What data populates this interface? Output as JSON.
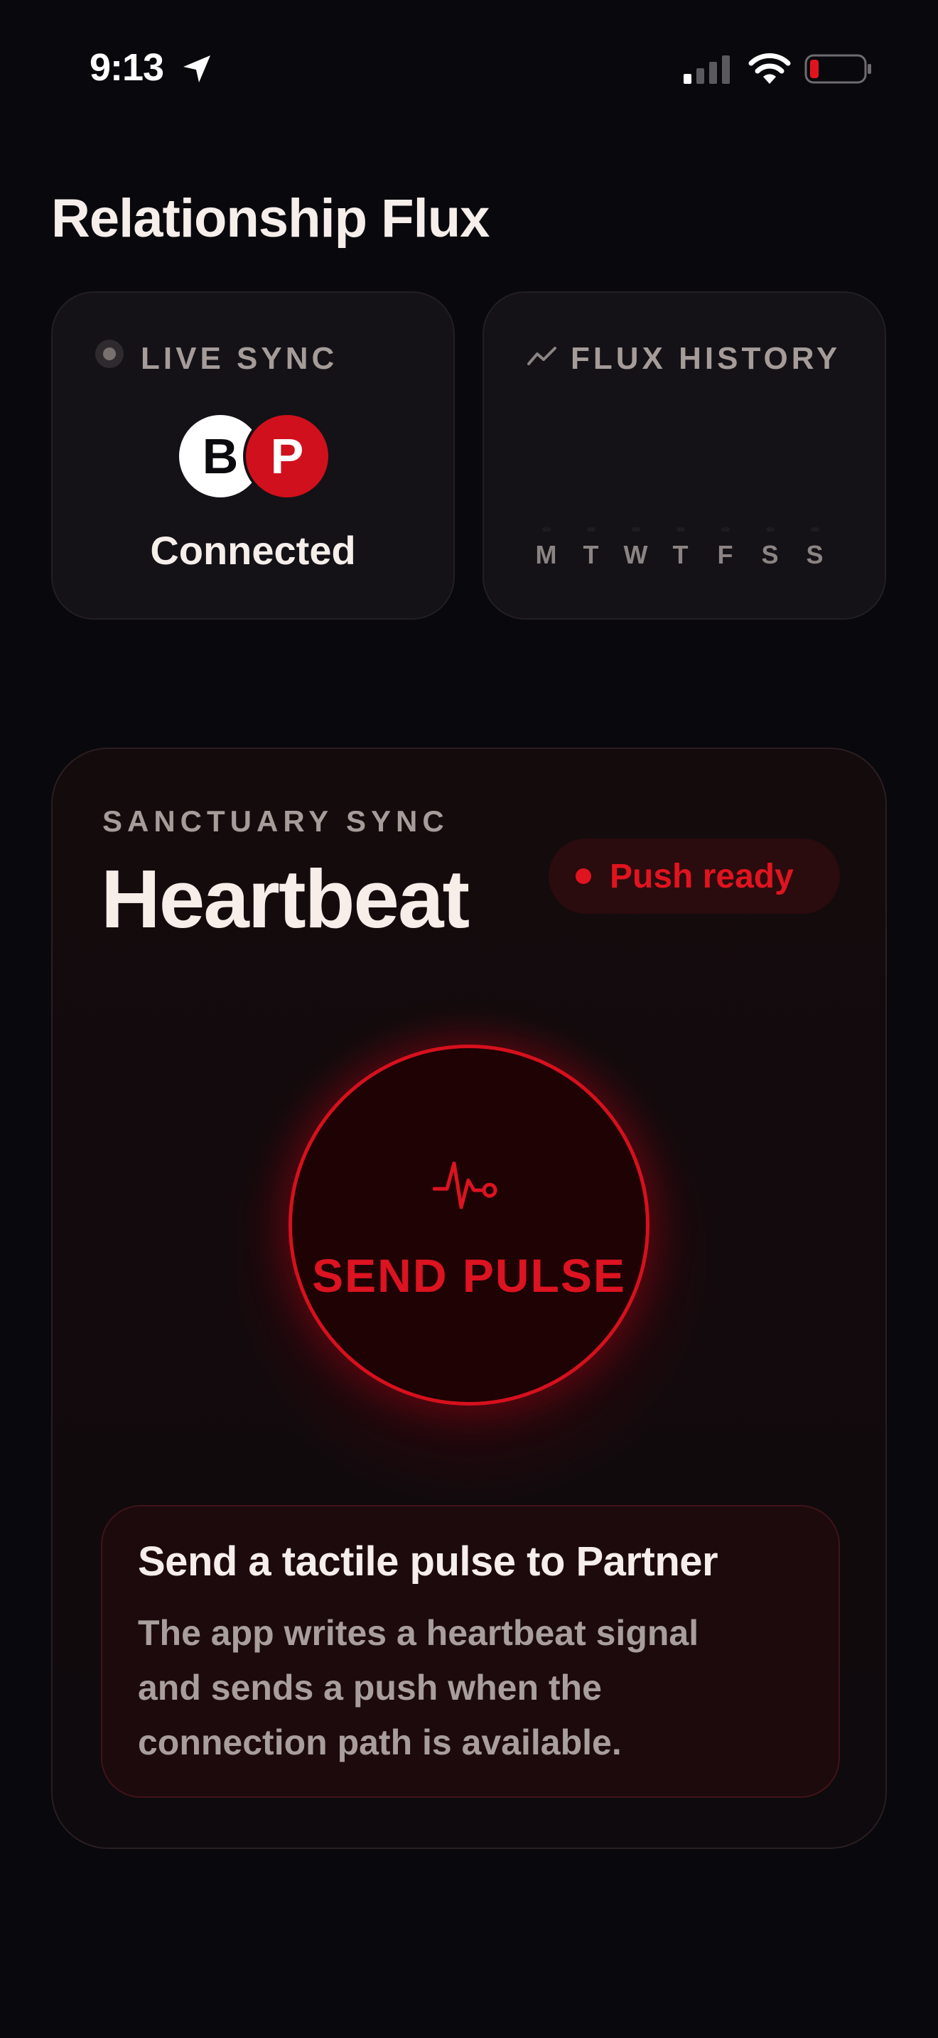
{
  "status_bar": {
    "time": "9:13",
    "battery_color": "#e0141f"
  },
  "header": {
    "title": "Relationship Flux"
  },
  "live_sync_card": {
    "label": "LIVE SYNC",
    "avatars": [
      "B",
      "P"
    ],
    "status": "Connected"
  },
  "flux_history_card": {
    "label": "FLUX HISTORY",
    "days": [
      "M",
      "T",
      "W",
      "T",
      "F",
      "S",
      "S"
    ]
  },
  "sanctuary": {
    "eyebrow": "SANCTUARY SYNC",
    "title": "Heartbeat",
    "badge": "Push ready",
    "pulse_button_label": "SEND PULSE",
    "info_heading": "Send a tactile pulse to Partner",
    "info_body": "The app writes a heartbeat signal and sends a push when the connection path is available."
  },
  "colors": {
    "accent": "#d7101d",
    "background": "#09080c",
    "card": "#141217"
  }
}
